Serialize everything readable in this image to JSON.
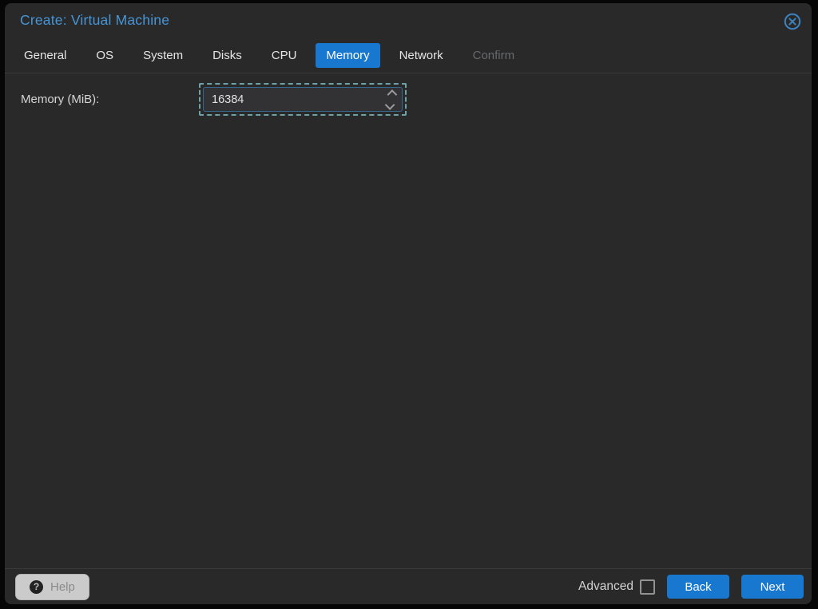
{
  "dialog": {
    "title": "Create: Virtual Machine"
  },
  "tabs": [
    {
      "label": "General",
      "state": "normal"
    },
    {
      "label": "OS",
      "state": "normal"
    },
    {
      "label": "System",
      "state": "normal"
    },
    {
      "label": "Disks",
      "state": "normal"
    },
    {
      "label": "CPU",
      "state": "normal"
    },
    {
      "label": "Memory",
      "state": "active"
    },
    {
      "label": "Network",
      "state": "normal"
    },
    {
      "label": "Confirm",
      "state": "disabled"
    }
  ],
  "form": {
    "memory_label": "Memory (MiB):",
    "memory_value": "16384"
  },
  "footer": {
    "help_label": "Help",
    "help_icon_glyph": "?",
    "advanced_label": "Advanced",
    "advanced_checked": false,
    "back_label": "Back",
    "next_label": "Next"
  },
  "icons": {
    "close": "circle-x-icon",
    "spinner_up": "chevron-up-icon",
    "spinner_down": "chevron-down-icon"
  },
  "colors": {
    "accent_blue": "#1878d0",
    "title_blue": "#4795d6",
    "close_icon_blue": "#3e83bd",
    "focus_dash_teal": "#6da2a6",
    "input_border_blue": "#35678f",
    "dialog_bg": "#29292a"
  }
}
